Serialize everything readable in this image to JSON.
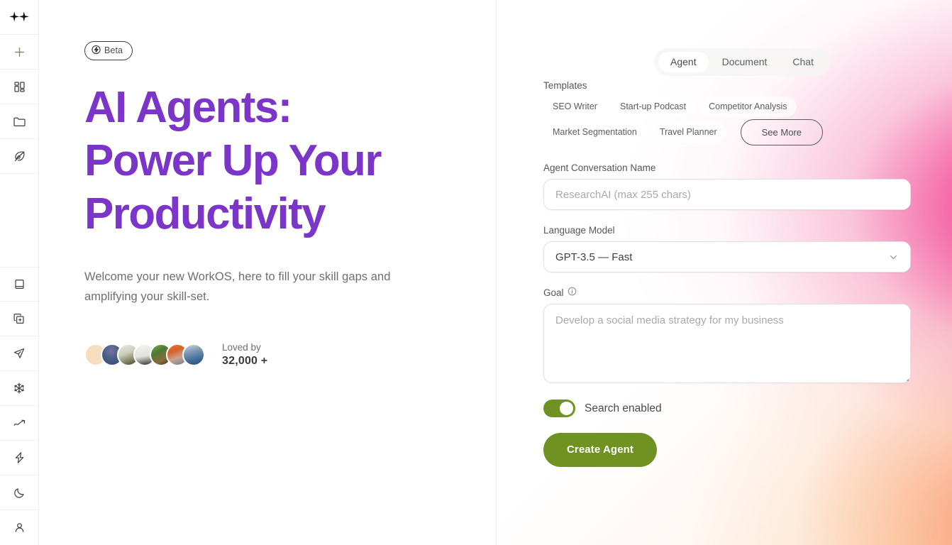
{
  "sidebar": {
    "items": [
      {
        "name": "sparkles-logo-icon",
        "label": "Sparkles"
      },
      {
        "name": "plus-icon",
        "label": "New"
      },
      {
        "name": "grid-dashboard-icon",
        "label": "Dashboard"
      },
      {
        "name": "folder-icon",
        "label": "Files"
      },
      {
        "name": "pen-nib-icon",
        "label": "Write"
      },
      {
        "name": "book-icon",
        "label": "Library"
      },
      {
        "name": "copy-plus-icon",
        "label": "Duplicate"
      },
      {
        "name": "send-icon",
        "label": "Send"
      },
      {
        "name": "snowflake-icon",
        "label": "Freeze"
      },
      {
        "name": "trending-up-icon",
        "label": "Analytics"
      },
      {
        "name": "zap-icon",
        "label": "Automations"
      },
      {
        "name": "moon-icon",
        "label": "Dark mode"
      },
      {
        "name": "user-icon",
        "label": "Account"
      }
    ]
  },
  "hero": {
    "badge": "Beta",
    "badge_icon": "lightning-bolt-icon",
    "title_line1": "AI Agents:",
    "title_line2": "Power Up Your",
    "title_line3": "Productivity",
    "subtitle": "Welcome your new WorkOS, here to fill your skill gaps and amplifying your skill-set.",
    "social_proof": {
      "caption": "Loved by",
      "count": "32,000 +",
      "avatar_count": 7
    },
    "accent_color": "#7b35c9"
  },
  "tabs": [
    {
      "label": "Agent",
      "active": true
    },
    {
      "label": "Document",
      "active": false
    },
    {
      "label": "Chat",
      "active": false
    }
  ],
  "form": {
    "templates_label": "Templates",
    "templates": [
      "SEO Writer",
      "Start-up Podcast",
      "Competitor Analysis",
      "Market Segmentation",
      "Travel Planner"
    ],
    "see_more_label": "See More",
    "conversation_name": {
      "label": "Agent Conversation Name",
      "value": "",
      "placeholder": "ResearchAI (max 255 chars)"
    },
    "language_model": {
      "label": "Language Model",
      "selected": "GPT-3.5 — Fast",
      "chevron_icon": "chevron-down-icon"
    },
    "goal": {
      "label": "Goal",
      "info_icon": "info-icon",
      "value": "",
      "placeholder": "Develop a social media strategy for my business"
    },
    "search_toggle": {
      "label": "Search enabled",
      "enabled": true
    },
    "submit_label": "Create Agent",
    "accent_color": "#6f9222"
  },
  "background": {
    "pink": "#f02280",
    "orange": "#f98760",
    "peach": "#fcce8c"
  }
}
